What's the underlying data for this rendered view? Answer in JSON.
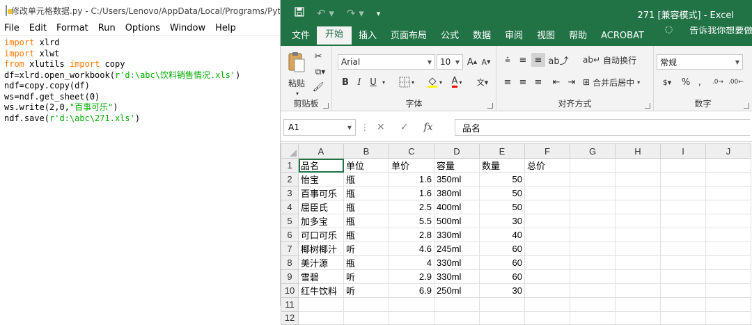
{
  "idle": {
    "title": "修改单元格数据.py - C:/Users/Lenovo/AppData/Local/Programs/Pytho",
    "menu": [
      "File",
      "Edit",
      "Format",
      "Run",
      "Options",
      "Window",
      "Help"
    ],
    "code": {
      "l1_kw": "import",
      "l1_rest": " xlrd",
      "l2_kw": "import",
      "l2_rest": " xlwt",
      "l3_kw1": "from",
      "l3_mid": " xlutils ",
      "l3_kw2": "import",
      "l3_rest": " copy",
      "l4_pre": "df=xlrd.open_workbook(",
      "l4_str": "r'd:\\abc\\饮料销售情况.xls'",
      "l4_post": ")",
      "l5": "ndf=copy.copy(df)",
      "l6": "ws=ndf.get_sheet(0)",
      "l7_pre": "ws.write(2,0,",
      "l7_str": "\"百事可乐\"",
      "l7_post": ")",
      "l8_pre": "ndf.save(",
      "l8_str": "r'd:\\abc\\271.xls'",
      "l8_post": ")"
    }
  },
  "excel": {
    "window_title": "271  [兼容模式]  -  Excel",
    "tabs": [
      "文件",
      "开始",
      "插入",
      "页面布局",
      "公式",
      "数据",
      "审阅",
      "视图",
      "帮助",
      "ACROBAT"
    ],
    "tell_me": "告诉我你想要做什么",
    "ribbon": {
      "paste": "粘贴",
      "clipboard": "剪贴板",
      "font_name": "Arial",
      "font_size": "10",
      "font_group": "字体",
      "wrap_text": "自动换行",
      "merge_center": "合并后居中",
      "align_group": "对齐方式",
      "number_format": "常规",
      "number_group": "数字",
      "bold": "B",
      "italic": "I",
      "underline": "U",
      "grow": "A",
      "shrink": "A"
    },
    "name_box": "A1",
    "formula_value": "品名",
    "columns": [
      "A",
      "B",
      "C",
      "D",
      "E",
      "F",
      "G",
      "H",
      "I",
      "J"
    ],
    "rows": [
      [
        "品名",
        "单位",
        "单价",
        "容量",
        "数量",
        "总价"
      ],
      [
        "怡宝",
        "瓶",
        "1.6",
        "350ml",
        "50",
        ""
      ],
      [
        "百事可乐",
        "瓶",
        "1.6",
        "380ml",
        "50",
        ""
      ],
      [
        "屈臣氏",
        "瓶",
        "2.5",
        "400ml",
        "50",
        ""
      ],
      [
        "加多宝",
        "瓶",
        "5.5",
        "500ml",
        "30",
        ""
      ],
      [
        "可口可乐",
        "瓶",
        "2.8",
        "330ml",
        "40",
        ""
      ],
      [
        "椰树椰汁",
        "听",
        "4.6",
        "245ml",
        "60",
        ""
      ],
      [
        "美汁源",
        "瓶",
        "4",
        "330ml",
        "60",
        ""
      ],
      [
        "雪碧",
        "听",
        "2.9",
        "330ml",
        "60",
        ""
      ],
      [
        "红牛饮料",
        "听",
        "6.9",
        "250ml",
        "30",
        ""
      ],
      [
        "",
        "",
        "",
        "",
        "",
        ""
      ],
      [
        "",
        "",
        "",
        "",
        "",
        ""
      ]
    ],
    "accent": "#217346"
  }
}
